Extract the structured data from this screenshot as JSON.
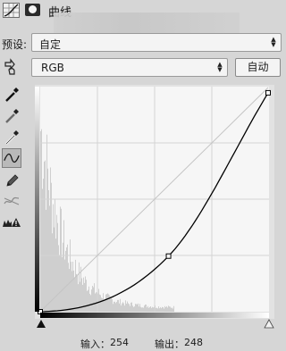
{
  "header": {
    "title": "曲线",
    "icons": [
      "curves-adjustment-icon",
      "layer-mask-icon"
    ]
  },
  "preset": {
    "label": "预设:",
    "value": "自定"
  },
  "channel": {
    "value": "RGB",
    "auto_label": "自动"
  },
  "tools": [
    "on-image-adjust-icon",
    "black-point-eyedropper-icon",
    "gray-point-eyedropper-icon",
    "white-point-eyedropper-icon",
    "curve-points-icon",
    "pencil-icon",
    "smooth-curve-icon",
    "clipping-warning-icon"
  ],
  "curve": {
    "input_range": [
      0,
      255
    ],
    "output_range": [
      0,
      255
    ],
    "points": [
      {
        "input": 0,
        "output": 0
      },
      {
        "input": 143,
        "output": 63
      },
      {
        "input": 254,
        "output": 248
      }
    ],
    "grid_divisions": 4,
    "histogram_skew": "dark"
  },
  "readout": {
    "input_label": "输入：",
    "input_value": "254",
    "output_label": "输出：",
    "output_value": "248"
  },
  "colors": {
    "panel_bg": "#d6d6d6",
    "canvas_bg": "#f6f6f6",
    "histogram": "#cfcfcf",
    "curve": "#000000"
  }
}
